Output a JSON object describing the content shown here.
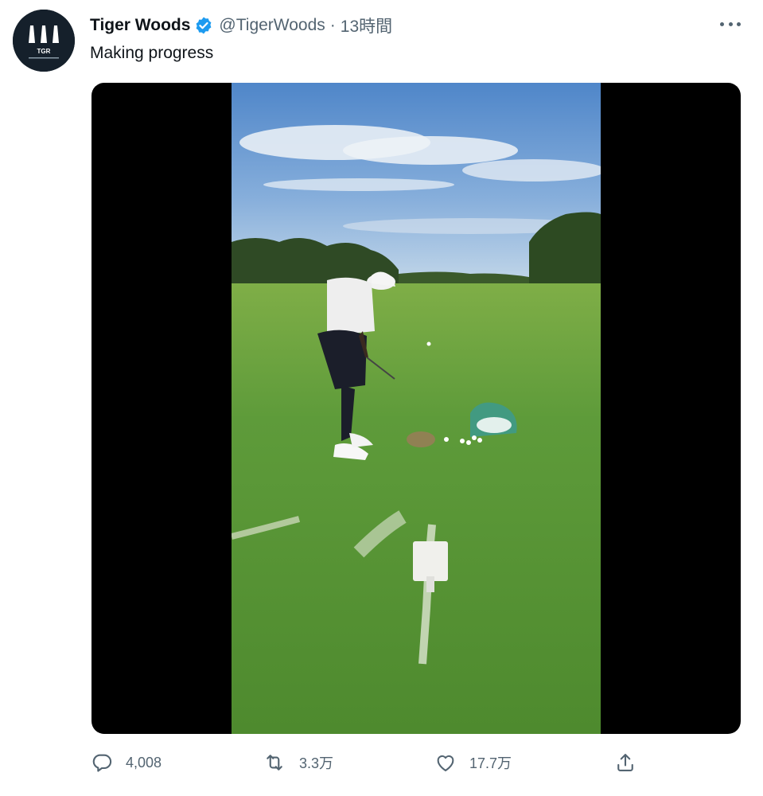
{
  "tweet": {
    "author_name": "Tiger Woods",
    "handle": "@TigerWoods",
    "separator": "·",
    "time": "13時間",
    "text": "Making progress",
    "avatar": {
      "logo_text": "TGR",
      "icon": "tgr-logo-icon"
    }
  },
  "media": {
    "type": "video",
    "icon": "golf-swing-video"
  },
  "actions": {
    "reply": {
      "count": "4,008",
      "icon": "reply-icon"
    },
    "retweet": {
      "count": "3.3万",
      "icon": "retweet-icon"
    },
    "like": {
      "count": "17.7万",
      "icon": "heart-icon"
    },
    "share": {
      "icon": "share-icon"
    }
  },
  "colors": {
    "text": "#0f1419",
    "secondary": "#536471",
    "verified": "#1d9bf0",
    "avatar_bg": "#15202b"
  }
}
